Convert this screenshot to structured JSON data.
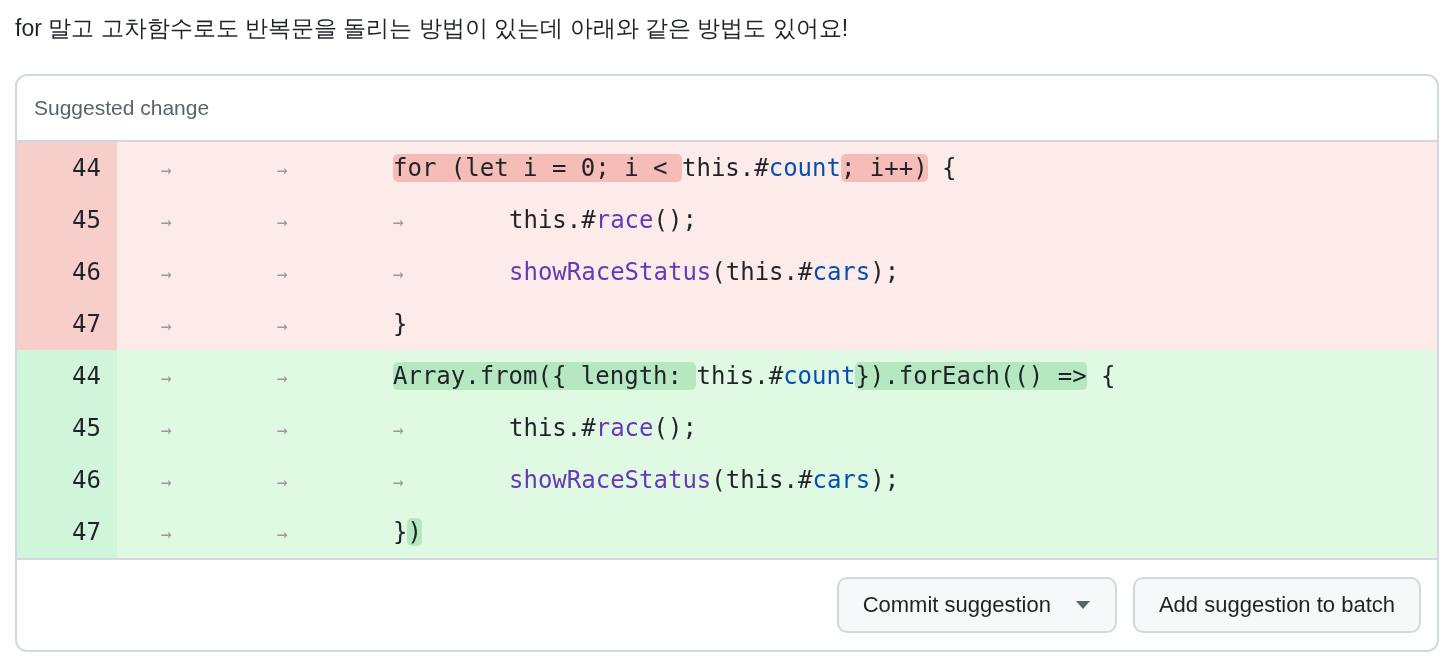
{
  "comment": "for 말고 고차함수로도 반복문을 돌리는 방법이 있는데 아래와 같은 방법도 있어요!",
  "suggestion": {
    "title": "Suggested change",
    "lines": [
      {
        "kind": "deletion",
        "number": "44",
        "indent": [
          "→",
          "→"
        ],
        "tokens": [
          {
            "text": "for (let i = 0; i < ",
            "kind": "plain",
            "marked": true
          },
          {
            "text": "this.#",
            "kind": "plain",
            "marked": false
          },
          {
            "text": "count",
            "kind": "prop",
            "marked": false
          },
          {
            "text": "; i++)",
            "kind": "plain",
            "marked": true
          },
          {
            "text": " {",
            "kind": "plain",
            "marked": false
          }
        ]
      },
      {
        "kind": "deletion",
        "number": "45",
        "indent": [
          "→",
          "→",
          "→"
        ],
        "tokens": [
          {
            "text": "this.#",
            "kind": "plain",
            "marked": false
          },
          {
            "text": "race",
            "kind": "func",
            "marked": false
          },
          {
            "text": "();",
            "kind": "plain",
            "marked": false
          }
        ]
      },
      {
        "kind": "deletion",
        "number": "46",
        "indent": [
          "→",
          "→",
          "→"
        ],
        "tokens": [
          {
            "text": "showRaceStatus",
            "kind": "func",
            "marked": false
          },
          {
            "text": "(this.#",
            "kind": "plain",
            "marked": false
          },
          {
            "text": "cars",
            "kind": "prop",
            "marked": false
          },
          {
            "text": ");",
            "kind": "plain",
            "marked": false
          }
        ]
      },
      {
        "kind": "deletion",
        "number": "47",
        "indent": [
          "→",
          "→"
        ],
        "tokens": [
          {
            "text": "}",
            "kind": "plain",
            "marked": false
          }
        ]
      },
      {
        "kind": "addition",
        "number": "44",
        "indent": [
          "→",
          "→"
        ],
        "tokens": [
          {
            "text": "Array.from({ length: ",
            "kind": "plain",
            "marked": true
          },
          {
            "text": "this.#",
            "kind": "plain",
            "marked": false
          },
          {
            "text": "count",
            "kind": "prop",
            "marked": false
          },
          {
            "text": "}).forEach(() =>",
            "kind": "plain",
            "marked": true
          },
          {
            "text": " {",
            "kind": "plain",
            "marked": false
          }
        ]
      },
      {
        "kind": "addition",
        "number": "45",
        "indent": [
          "→",
          "→",
          "→"
        ],
        "tokens": [
          {
            "text": "this.#",
            "kind": "plain",
            "marked": false
          },
          {
            "text": "race",
            "kind": "func",
            "marked": false
          },
          {
            "text": "();",
            "kind": "plain",
            "marked": false
          }
        ]
      },
      {
        "kind": "addition",
        "number": "46",
        "indent": [
          "→",
          "→",
          "→"
        ],
        "tokens": [
          {
            "text": "showRaceStatus",
            "kind": "func",
            "marked": false
          },
          {
            "text": "(this.#",
            "kind": "plain",
            "marked": false
          },
          {
            "text": "cars",
            "kind": "prop",
            "marked": false
          },
          {
            "text": ");",
            "kind": "plain",
            "marked": false
          }
        ]
      },
      {
        "kind": "addition",
        "number": "47",
        "indent": [
          "→",
          "→"
        ],
        "tokens": [
          {
            "text": "}",
            "kind": "plain",
            "marked": false
          },
          {
            "text": ")",
            "kind": "plain",
            "marked": true
          }
        ]
      }
    ],
    "buttons": [
      {
        "label": "Commit suggestion",
        "kind": "dropdown"
      },
      {
        "label": "Add suggestion to batch",
        "kind": "plain"
      }
    ]
  }
}
